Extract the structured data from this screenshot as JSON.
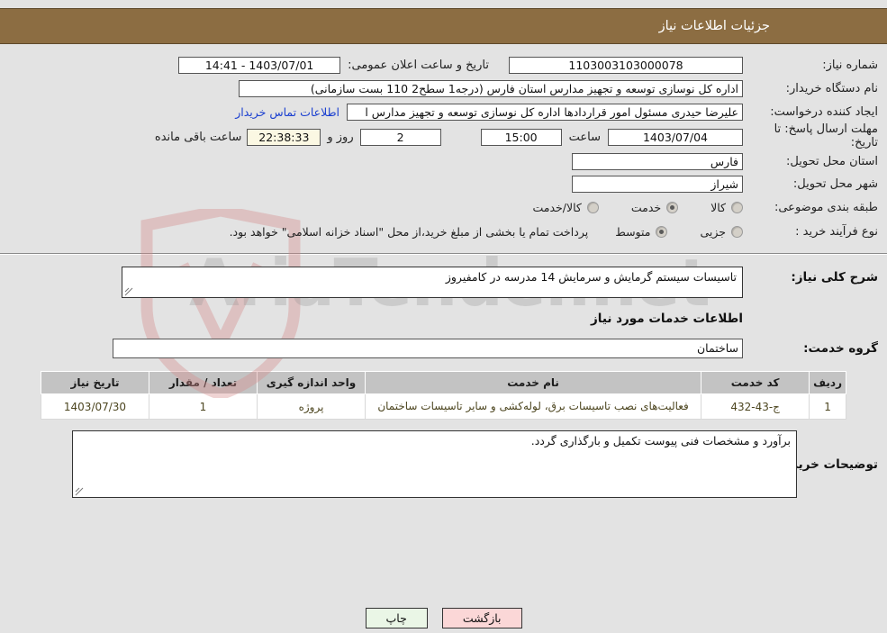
{
  "header": {
    "title": "جزئیات اطلاعات نیاز"
  },
  "form": {
    "need_number_label": "شماره نیاز:",
    "need_number_value": "1103003103000078",
    "announce_label": "تاریخ و ساعت اعلان عمومی:",
    "announce_value": "1403/07/01 - 14:41",
    "buyer_org_label": "نام دستگاه خریدار:",
    "buyer_org_value": "اداره کل نوسازی  توسعه و تجهیز مدارس استان فارس (درجه1  سطح2  110 بست سازمانی)",
    "requester_label": "ایجاد کننده درخواست:",
    "requester_value": "علیرضا حیدری مسئول امور قراردادها اداره کل نوسازی   توسعه و تجهیز مدارس ا",
    "contact_link": "اطلاعات تماس خریدار",
    "deadline_label": "مهلت ارسال پاسخ: تا تاریخ:",
    "deadline_date": "1403/07/04",
    "deadline_time_label": "ساعت",
    "deadline_time": "15:00",
    "remaining_days": "2",
    "remaining_days_label": "روز و",
    "remaining_time": "22:38:33",
    "remaining_suffix": "ساعت باقی مانده",
    "province_label": "استان محل تحویل:",
    "province_value": "فارس",
    "city_label": "شهر محل تحویل:",
    "city_value": "شیراز",
    "category_label": "طبقه بندی موضوعی:",
    "category_options": [
      {
        "label": "کالا",
        "selected": false
      },
      {
        "label": "خدمت",
        "selected": true
      },
      {
        "label": "کالا/خدمت",
        "selected": false
      }
    ],
    "process_label": "نوع فرآیند خرید :",
    "process_options": [
      {
        "label": "جزیی",
        "selected": false
      },
      {
        "label": "متوسط",
        "selected": true
      }
    ],
    "payment_note": "پرداخت تمام یا بخشی از مبلغ خرید،از محل \"اسناد خزانه اسلامی\" خواهد بود."
  },
  "need_summary": {
    "label": "شرح کلی نیاز:",
    "value": "تاسیسات سیستم گرمایش و سرمایش 14 مدرسه در کامفیروز"
  },
  "services": {
    "section_title": "اطلاعات خدمات مورد نیاز",
    "group_label": "گروه خدمت:",
    "group_value": "ساختمان",
    "columns": [
      "ردیف",
      "کد خدمت",
      "نام خدمت",
      "واحد اندازه گیری",
      "تعداد / مقدار",
      "تاریخ نیاز"
    ],
    "rows": [
      {
        "index": "1",
        "code": "ج-43-432",
        "name": "فعالیت‌های نصب تاسیسات برق، لوله‌کشی و سایر تاسیسات ساختمان",
        "unit": "پروژه",
        "quantity": "1",
        "date": "1403/07/30"
      }
    ]
  },
  "buyer_notes": {
    "label": "توضیحات خریدار:",
    "value": "برآورد و مشخصات فنی پیوست تکمیل و بارگذاری گردد."
  },
  "footer": {
    "print_label": "چاپ",
    "back_label": "بازگشت"
  },
  "watermark": {
    "text": "AriaTender.net"
  }
}
